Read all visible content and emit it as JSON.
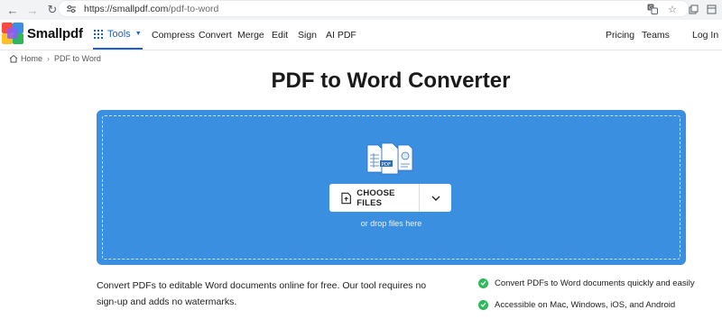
{
  "browser": {
    "url_host": "https://smallpdf.com",
    "url_path": "/pdf-to-word"
  },
  "header": {
    "brand": "Smallpdf",
    "tools_label": "Tools",
    "nav": [
      "Compress",
      "Convert",
      "Merge",
      "Edit",
      "Sign",
      "AI PDF"
    ],
    "pricing": "Pricing",
    "teams": "Teams",
    "login": "Log In"
  },
  "breadcrumb": {
    "home": "Home",
    "current": "PDF to Word"
  },
  "main": {
    "title": "PDF to Word Converter",
    "choose_files": "CHOOSE FILES",
    "drop_text": "or drop files here",
    "description": "Convert PDFs to editable Word documents online for free. Our tool requires no sign-up and adds no watermarks.",
    "features": [
      "Convert PDFs to Word documents quickly and easily",
      "Accessible on Mac, Windows, iOS, and Android"
    ]
  },
  "colors": {
    "accent": "#1b5fd6",
    "dropzone": "#3b8fe0",
    "check": "#2eb85c"
  },
  "icons": {
    "back": "arrow-left-icon",
    "forward": "arrow-right-icon",
    "reload": "reload-icon",
    "site_settings": "tune-icon",
    "translate": "translate-icon",
    "bookmark": "star-icon"
  }
}
